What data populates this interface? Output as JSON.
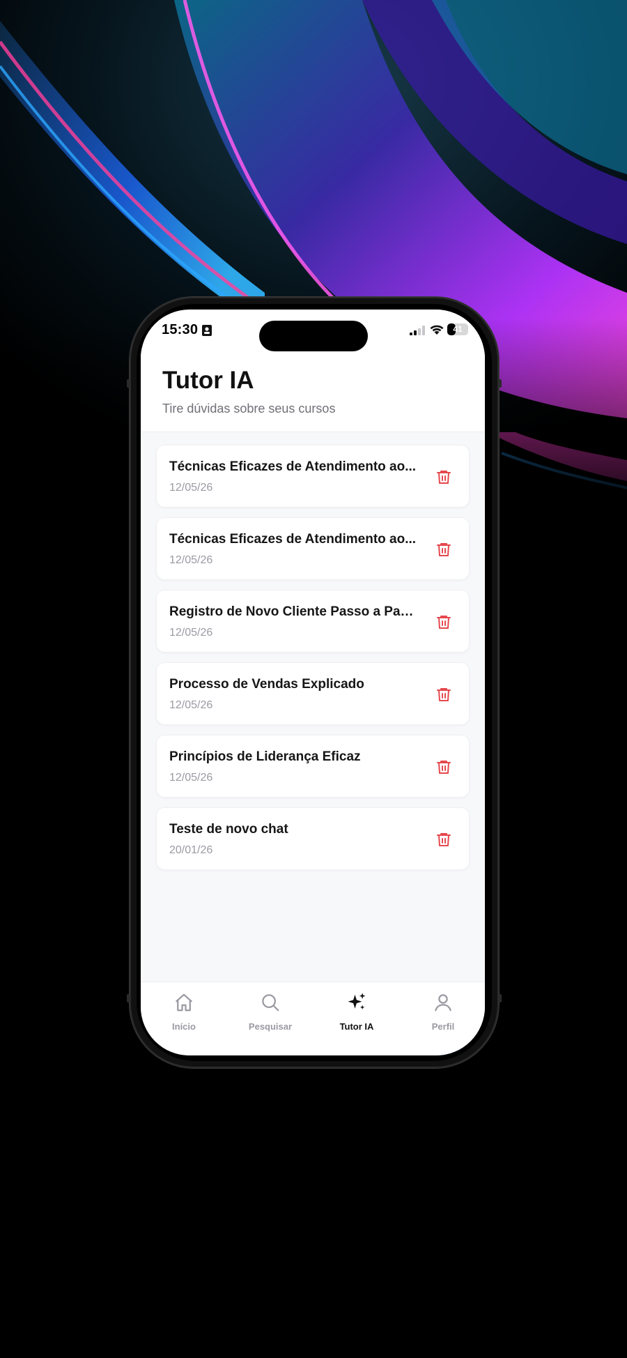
{
  "status_bar": {
    "time": "15:30",
    "battery_text": "41",
    "battery_level": 0.41
  },
  "header": {
    "title": "Tutor IA",
    "subtitle": "Tire dúvidas sobre seus cursos"
  },
  "chats": [
    {
      "title": "Técnicas Eficazes de Atendimento ao...",
      "date": "12/05/26"
    },
    {
      "title": "Técnicas Eficazes de Atendimento ao...",
      "date": "12/05/26"
    },
    {
      "title": "Registro de Novo Cliente Passo a Passo",
      "date": "12/05/26"
    },
    {
      "title": "Processo de Vendas Explicado",
      "date": "12/05/26"
    },
    {
      "title": "Princípios de Liderança Eficaz",
      "date": "12/05/26"
    },
    {
      "title": "Teste de novo chat",
      "date": "20/01/26"
    }
  ],
  "tabs": [
    {
      "label": "Início",
      "icon": "home-icon",
      "active": false
    },
    {
      "label": "Pesquisar",
      "icon": "search-icon",
      "active": false
    },
    {
      "label": "Tutor IA",
      "icon": "sparkles-icon",
      "active": true
    },
    {
      "label": "Perfil",
      "icon": "user-icon",
      "active": false
    }
  ],
  "colors": {
    "accent": "#0b63f6",
    "delete": "#e5484d",
    "active_tab": "#111111",
    "inactive_tab": "#9a9aa2"
  }
}
